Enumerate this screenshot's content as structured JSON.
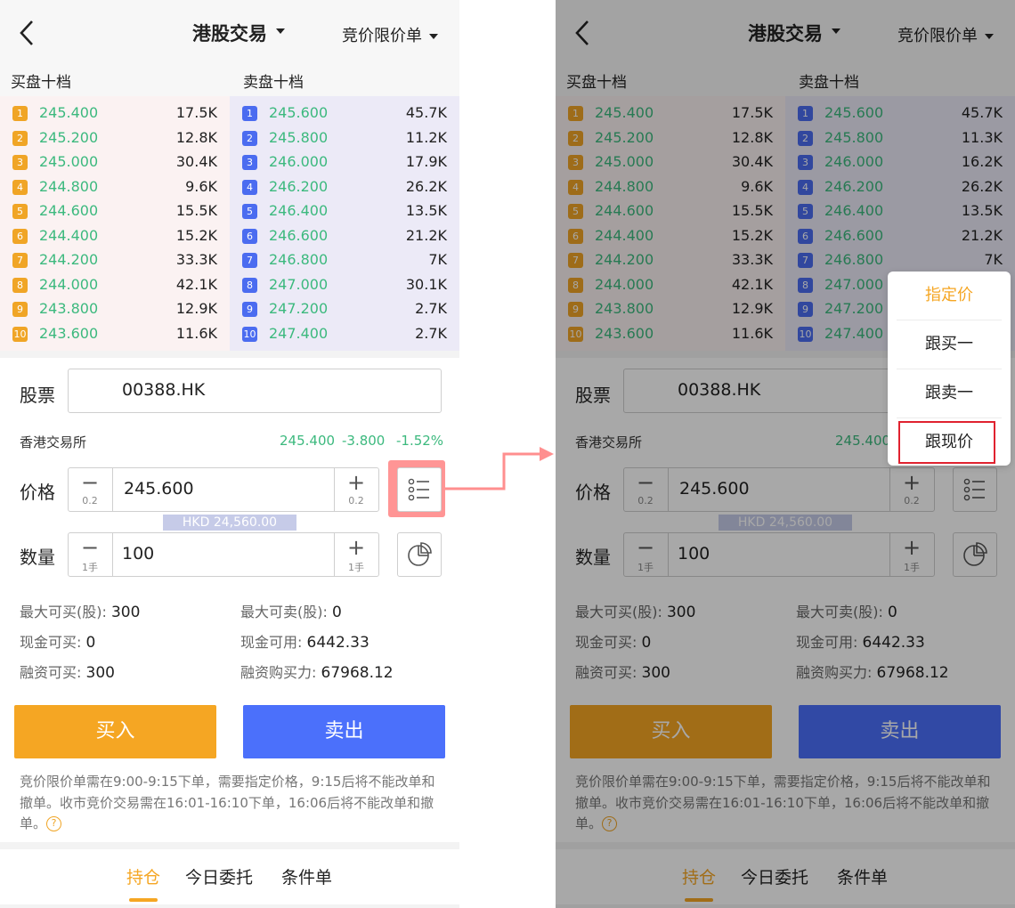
{
  "header": {
    "title": "港股交易",
    "order_type": "竞价限价单"
  },
  "book": {
    "bid_title": "买盘十档",
    "ask_title": "卖盘十档",
    "bids": [
      {
        "n": "1",
        "price": "245.400",
        "vol": "17.5K"
      },
      {
        "n": "2",
        "price": "245.200",
        "vol": "12.8K"
      },
      {
        "n": "3",
        "price": "245.000",
        "vol": "30.4K"
      },
      {
        "n": "4",
        "price": "244.800",
        "vol": "9.6K"
      },
      {
        "n": "5",
        "price": "244.600",
        "vol": "15.5K"
      },
      {
        "n": "6",
        "price": "244.400",
        "vol": "15.2K"
      },
      {
        "n": "7",
        "price": "244.200",
        "vol": "33.3K"
      },
      {
        "n": "8",
        "price": "244.000",
        "vol": "42.1K"
      },
      {
        "n": "9",
        "price": "243.800",
        "vol": "12.9K"
      },
      {
        "n": "10",
        "price": "243.600",
        "vol": "11.6K"
      }
    ],
    "asks_left": [
      {
        "n": "1",
        "price": "245.600",
        "vol": "45.7K"
      },
      {
        "n": "2",
        "price": "245.800",
        "vol": "11.2K"
      },
      {
        "n": "3",
        "price": "246.000",
        "vol": "17.9K"
      },
      {
        "n": "4",
        "price": "246.200",
        "vol": "26.2K"
      },
      {
        "n": "5",
        "price": "246.400",
        "vol": "13.5K"
      },
      {
        "n": "6",
        "price": "246.600",
        "vol": "21.2K"
      },
      {
        "n": "7",
        "price": "246.800",
        "vol": "7K"
      },
      {
        "n": "8",
        "price": "247.000",
        "vol": "30.1K"
      },
      {
        "n": "9",
        "price": "247.200",
        "vol": "2.7K"
      },
      {
        "n": "10",
        "price": "247.400",
        "vol": "2.7K"
      }
    ],
    "asks_right": [
      {
        "n": "1",
        "price": "245.600",
        "vol": "45.7K"
      },
      {
        "n": "2",
        "price": "245.800",
        "vol": "11.3K"
      },
      {
        "n": "3",
        "price": "246.000",
        "vol": "16.2K"
      },
      {
        "n": "4",
        "price": "246.200",
        "vol": "26.2K"
      },
      {
        "n": "5",
        "price": "246.400",
        "vol": "13.5K"
      },
      {
        "n": "6",
        "price": "246.600",
        "vol": "21.2K"
      },
      {
        "n": "7",
        "price": "246.800",
        "vol": "7K"
      },
      {
        "n": "8",
        "price": "247.000",
        "vol": ""
      },
      {
        "n": "9",
        "price": "247.200",
        "vol": ""
      },
      {
        "n": "10",
        "price": "247.400",
        "vol": ""
      }
    ]
  },
  "form": {
    "stock_label": "股票",
    "stock_value": "00388.HK",
    "exchange": "香港交易所",
    "quote_price": "245.400",
    "quote_change": "-3.800",
    "quote_pct": "-1.52%",
    "price_label": "价格",
    "price_value": "245.600",
    "price_step": "0.2",
    "amount": "HKD 24,560.00",
    "qty_label": "数量",
    "qty_value": "100",
    "qty_step": "1手",
    "minus": "−",
    "plus": "+"
  },
  "account": {
    "max_buy_label": "最大可买(股):",
    "max_buy": "300",
    "max_sell_label": "最大可卖(股):",
    "max_sell": "0",
    "cash_buy_label": "现金可买:",
    "cash_buy": "0",
    "cash_avail_label": "现金可用:",
    "cash_avail": "6442.33",
    "margin_buy_label": "融资可买:",
    "margin_buy": "300",
    "margin_power_label": "融资购买力:",
    "margin_power": "67968.12"
  },
  "actions": {
    "buy": "买入",
    "sell": "卖出"
  },
  "note": {
    "text": "竞价限价单需在9:00-9:15下单，需要指定价格，9:15后将不能改单和撤单。收市竞价交易需在16:01-16:10下单，16:06后将不能改单和撤单。",
    "help": "?"
  },
  "tabs": [
    "持仓",
    "今日委托",
    "条件单"
  ],
  "price_menu": [
    "指定价",
    "跟买一",
    "跟卖一",
    "跟现价"
  ],
  "colors": {
    "accent": "#f5a623",
    "sell": "#4b70fb",
    "up_green": "#3cb97e",
    "highlight": "#e0222f"
  },
  "icons": [
    "back-arrow-icon",
    "caret-down-icon",
    "list-icon",
    "pie-chart-icon",
    "help-icon",
    "arrow-right-icon"
  ]
}
